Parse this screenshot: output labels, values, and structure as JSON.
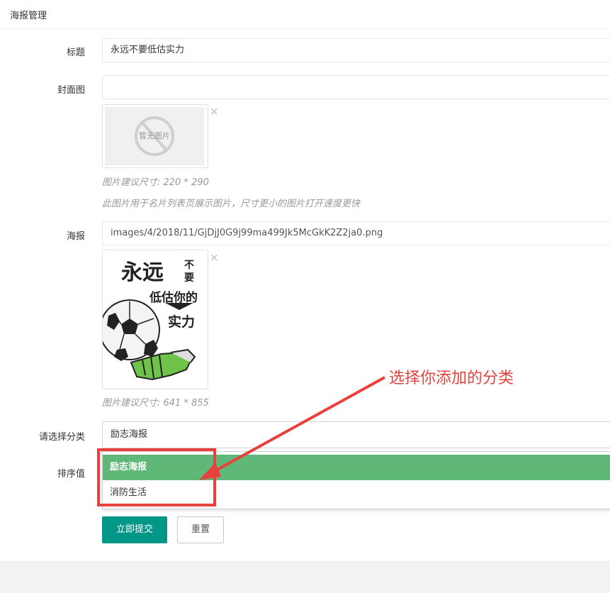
{
  "panel": {
    "title": "海报管理"
  },
  "form": {
    "title": {
      "label": "标题",
      "value": "永远不要低估实力"
    },
    "cover": {
      "label": "封面图",
      "value": "",
      "placeholder_image_text": "暂无图片",
      "hint_size": "图片建议尺寸: 220 * 290",
      "hint_usage": "此图片用于名片列表页展示图片，尺寸更小的图片打开速度更快"
    },
    "poster": {
      "label": "海报",
      "value": "images/4/2018/11/GjDjJ0G9j99ma499Jk5McGkK2Z2ja0.png",
      "hint_size": "图片建议尺寸: 641 * 855"
    },
    "poster_image_text": {
      "line1": "永远",
      "side1": "不",
      "side2": "要",
      "line2": "低估你的",
      "line3": "实力"
    },
    "category": {
      "label": "请选择分类",
      "selected": "励志海报",
      "options": [
        "励志海报",
        "消防生活"
      ]
    },
    "sort": {
      "label": "排序值"
    },
    "submit_label": "立即提交",
    "reset_label": "重置",
    "close_glyph": "×"
  },
  "annotation": {
    "text": "选择你添加的分类",
    "color": "#e8413d"
  },
  "colors": {
    "primary": "#009688",
    "option_selected": "#5fb878",
    "annotation": "#e8413d"
  }
}
